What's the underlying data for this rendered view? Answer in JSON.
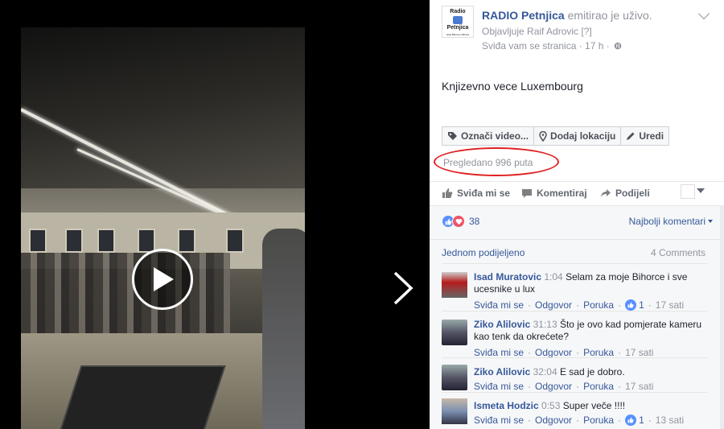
{
  "post": {
    "page_name": "RADIO Petnjica",
    "action": "emitirao je uživo.",
    "published_by": "Objavljuje Raif Adrovic [?]",
    "meta": "Sviđa vam se stranica · 17 h ·",
    "logo_line1": "Radio",
    "logo_line2": "Petnjica",
    "logo_line3": "Glas Bihora iz Bihora",
    "text": "Knjizevno vece Luxembourg"
  },
  "buttons": {
    "tag": "Označi video...",
    "location": "Dodaj lokaciju",
    "edit": "Uredi"
  },
  "views": "Pregledano 996 puta",
  "actions": {
    "like": "Sviđa mi se",
    "comment": "Komentiraj",
    "share": "Podijeli"
  },
  "reactions": {
    "count": "38",
    "sort": "Najbolji komentari"
  },
  "shares": {
    "shared": "Jednom podijeljeno",
    "comments_count": "4 Comments"
  },
  "comment_actions": {
    "like": "Sviđa mi se",
    "reply": "Odgovor",
    "message": "Poruka"
  },
  "comments": [
    {
      "name": "Isad Muratovic",
      "time": "1:04",
      "text": "Selam za moje Bihorce i sve ucesnike u lux",
      "likes": "1",
      "ago": "17 sati"
    },
    {
      "name": "Ziko Alilovic",
      "time": "31:13",
      "text": "Što je ovo kad pomjerate kameru kao tenk da okrećete?",
      "likes": "",
      "ago": "17 sati"
    },
    {
      "name": "Ziko Alilovic",
      "time": "32:04",
      "text": "E sad je dobro.",
      "likes": "",
      "ago": "17 sati"
    },
    {
      "name": "Ismeta Hodzic",
      "time": "0:53",
      "text": "Super veče !!!!",
      "likes": "1",
      "ago": "13 sati"
    }
  ],
  "colors": {
    "link": "#365899",
    "muted": "#90949c",
    "like_blue": "#5890ff",
    "love_red": "#f25268",
    "annotation_red": "#e02020"
  }
}
